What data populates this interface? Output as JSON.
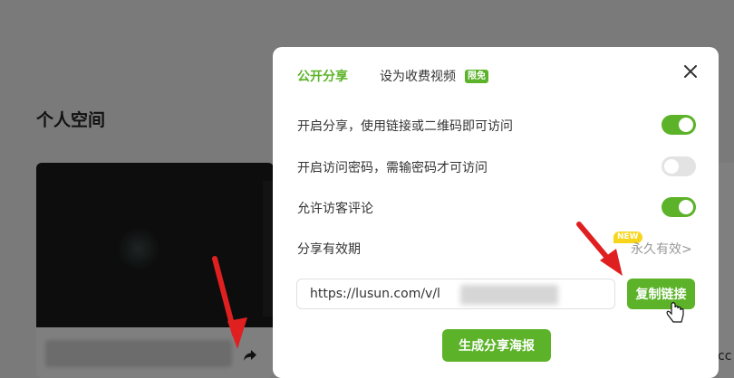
{
  "background": {
    "page_title": "个人空间",
    "share_icon": "share-arrow-icon",
    "right_text": "cc"
  },
  "modal": {
    "tabs": [
      {
        "label": "公开分享",
        "active": true
      },
      {
        "label": "设为收费视频",
        "active": false,
        "badge": "限免"
      }
    ],
    "close_icon": "close-icon",
    "settings": [
      {
        "label": "开启分享，使用链接或二维码即可访问",
        "enabled": true
      },
      {
        "label": "开启访问密码，需输密码才可访问",
        "enabled": false
      },
      {
        "label": "允许访客评论",
        "enabled": true
      }
    ],
    "expiry": {
      "label": "分享有效期",
      "new_badge": "NEW",
      "value": "永久有效>"
    },
    "link": {
      "url_visible": "https://lusun.com/v/l"
    },
    "copy_button": "复制链接",
    "poster_button": "生成分享海报"
  },
  "colors": {
    "accent": "#5cb329",
    "new_badge": "#f7d51a",
    "annotation_arrow": "#e02020"
  }
}
